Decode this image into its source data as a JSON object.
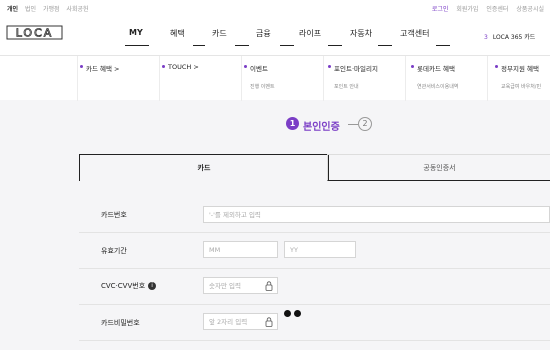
{
  "util_left": [
    "개인",
    "법인",
    "가맹점",
    "사회공헌"
  ],
  "util_right": [
    "로그인",
    "회원가입",
    "인증센터",
    "상품공시실"
  ],
  "logo": "LOCA",
  "gnb": [
    "MY",
    "혜택",
    "카드",
    "금융",
    "라이프",
    "자동차",
    "고객센터"
  ],
  "loca365": {
    "num": "3",
    "label": "LOCA 365 카드"
  },
  "subnav": [
    {
      "title": "카드 혜택 >",
      "sub": ""
    },
    {
      "title": "TOUCH >",
      "sub": ""
    },
    {
      "title": "이벤트",
      "sub": "진행 이벤트"
    },
    {
      "title": "포인트·마일리지",
      "sub": "포인트 안내"
    },
    {
      "title": "롯데카드 혜택",
      "sub": "연관서비스이용내역"
    },
    {
      "title": "정부지원 혜택",
      "sub": "교육급여 바우처/민"
    }
  ],
  "steps": {
    "step1_num": "1",
    "step1_label": "본인인증",
    "step2_num": "2"
  },
  "tabs": {
    "active": "카드",
    "other": "공동인증서"
  },
  "form": {
    "card_number": {
      "label": "카드번호",
      "placeholder": "'-'를 제외하고 입력"
    },
    "expiry": {
      "label": "유효기간",
      "mm": "MM",
      "yy": "YY"
    },
    "cvc": {
      "label": "CVC·CVV번호",
      "info_icon": "i",
      "placeholder": "숫자만 입력"
    },
    "pin": {
      "label": "카드비밀번호",
      "placeholder": "앞 2자리 입력"
    }
  },
  "colors": {
    "accent": "#7b3ec6"
  }
}
